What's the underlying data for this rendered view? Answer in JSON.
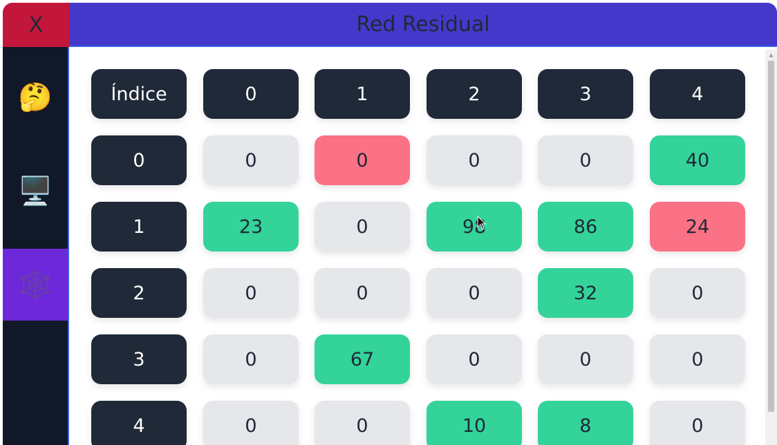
{
  "window": {
    "close_label": "X",
    "title": "Red Residual"
  },
  "sidebar": {
    "items": [
      {
        "icon": "thinking-face-icon",
        "glyph": "🤔",
        "active": false
      },
      {
        "icon": "desktop-computer-icon",
        "glyph": "🖥️",
        "active": false
      },
      {
        "icon": "spider-web-icon",
        "glyph": "🕸️",
        "active": true
      }
    ]
  },
  "matrix": {
    "corner_label": "Índice",
    "column_headers": [
      "0",
      "1",
      "2",
      "3",
      "4"
    ],
    "rows": [
      {
        "label": "0",
        "cells": [
          {
            "value": "0",
            "status": "zero"
          },
          {
            "value": "0",
            "status": "negative"
          },
          {
            "value": "0",
            "status": "zero"
          },
          {
            "value": "0",
            "status": "zero"
          },
          {
            "value": "40",
            "status": "positive"
          }
        ]
      },
      {
        "label": "1",
        "cells": [
          {
            "value": "23",
            "status": "positive"
          },
          {
            "value": "0",
            "status": "zero"
          },
          {
            "value": "98",
            "status": "positive"
          },
          {
            "value": "86",
            "status": "positive"
          },
          {
            "value": "24",
            "status": "negative"
          }
        ]
      },
      {
        "label": "2",
        "cells": [
          {
            "value": "0",
            "status": "zero"
          },
          {
            "value": "0",
            "status": "zero"
          },
          {
            "value": "0",
            "status": "zero"
          },
          {
            "value": "32",
            "status": "positive"
          },
          {
            "value": "0",
            "status": "zero"
          }
        ]
      },
      {
        "label": "3",
        "cells": [
          {
            "value": "0",
            "status": "zero"
          },
          {
            "value": "67",
            "status": "positive"
          },
          {
            "value": "0",
            "status": "zero"
          },
          {
            "value": "0",
            "status": "zero"
          },
          {
            "value": "0",
            "status": "zero"
          }
        ]
      },
      {
        "label": "4",
        "cells": [
          {
            "value": "0",
            "status": "zero"
          },
          {
            "value": "0",
            "status": "zero"
          },
          {
            "value": "10",
            "status": "positive"
          },
          {
            "value": "8",
            "status": "positive"
          },
          {
            "value": "0",
            "status": "zero"
          }
        ]
      }
    ]
  },
  "colors": {
    "close": "#c2173b",
    "title_bar": "#4338ca",
    "sidebar": "#111827",
    "sidebar_active": "#6d28d9",
    "header_cell": "#1f2937",
    "zero_cell": "#e5e7eb",
    "positive_cell": "#34d399",
    "negative_cell": "#fb7185"
  }
}
